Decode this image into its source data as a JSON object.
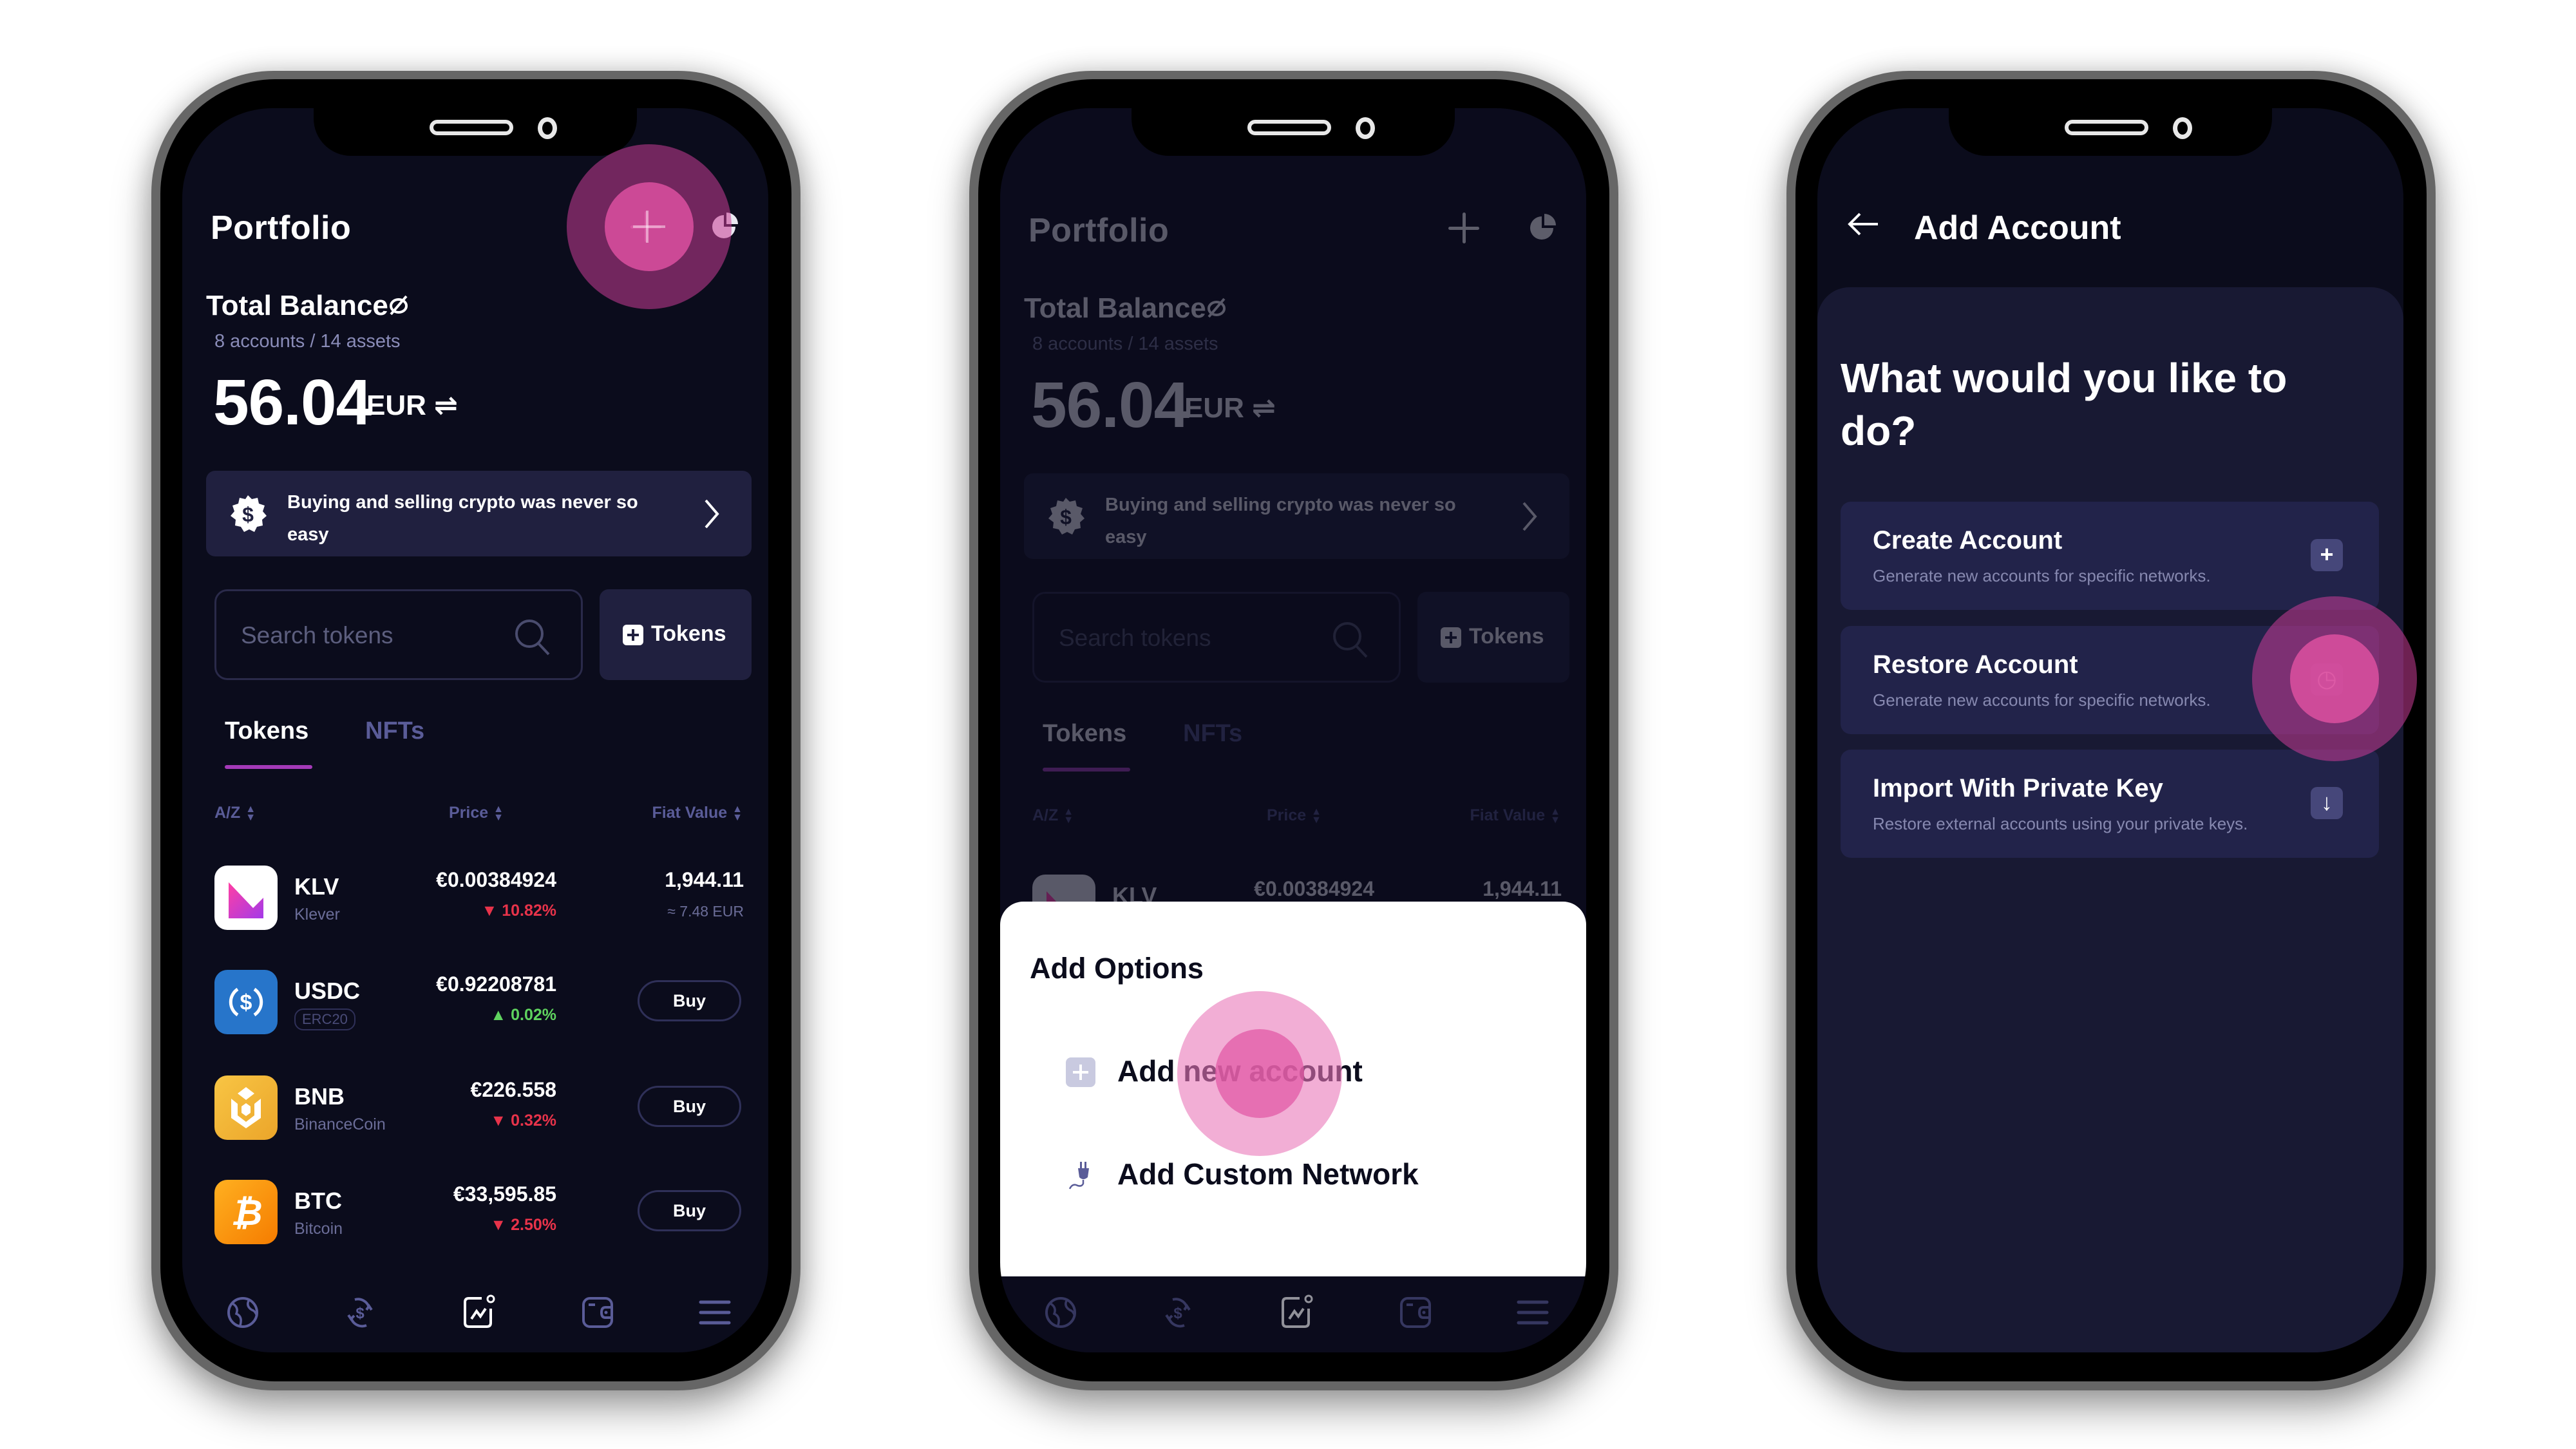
{
  "colors": {
    "background": "#ffffff",
    "screen_bg": "#0b0c1c",
    "card_bg": "#20203f",
    "accent_tab": "#a43ab8",
    "tap_highlight": "#d94a9e",
    "down": "#e8334a",
    "up": "#5fd35f",
    "muted_text": "#5a5c98"
  },
  "portfolio": {
    "title": "Portfolio",
    "add_icon": "plus-icon",
    "chart_icon": "pie-chart-icon",
    "balance_label": "Total Balance",
    "hide_icon": "eye-off-icon",
    "accounts_summary": "8 accounts / 14 assets",
    "balance_amount": "56.04",
    "balance_currency": "EUR",
    "currency_switch_icon": "swap-icon",
    "banner": {
      "icon": "dollar-badge-icon",
      "text": "Buying and selling crypto was never so easy",
      "chevron": "chevron-right-icon"
    },
    "search": {
      "placeholder": "Search tokens"
    },
    "add_tokens_label": "Tokens",
    "tabs": [
      {
        "label": "Tokens",
        "active": true
      },
      {
        "label": "NFTs",
        "active": false
      }
    ],
    "columns": {
      "name": "A/Z",
      "price": "Price",
      "fiat": "Fiat Value"
    },
    "tokens": [
      {
        "symbol": "KLV",
        "name": "Klever",
        "price": "€0.00384924",
        "change": "▼ 10.82%",
        "direction": "down",
        "fiat": "1,944.11",
        "fiat_sub": "≈ 7.48 EUR"
      },
      {
        "symbol": "USDC",
        "badge": "ERC20",
        "price": "€0.92208781",
        "change": "▲ 0.02%",
        "direction": "up",
        "action": "Buy"
      },
      {
        "symbol": "BNB",
        "name": "BinanceCoin",
        "price": "€226.558",
        "change": "▼ 0.32%",
        "direction": "down",
        "action": "Buy"
      },
      {
        "symbol": "BTC",
        "name": "Bitcoin",
        "price": "€33,595.85",
        "change": "▼ 2.50%",
        "direction": "down",
        "action": "Buy"
      }
    ],
    "nav": [
      "globe-icon",
      "exchange-dollar-icon",
      "portfolio-chart-icon",
      "wallet-icon",
      "menu-icon"
    ],
    "nav_active_index": 2
  },
  "add_options": {
    "title": "Add Options",
    "items": [
      {
        "label": "Add new account",
        "icon": "plus-square-icon"
      },
      {
        "label": "Add Custom Network",
        "icon": "plug-icon"
      }
    ]
  },
  "add_account": {
    "title": "Add Account",
    "back_icon": "arrow-left-icon",
    "heading": "What would you like to do?",
    "options": [
      {
        "title": "Create Account",
        "desc": "Generate new accounts for specific networks.",
        "icon": "+"
      },
      {
        "title": "Restore Account",
        "desc": "Generate new accounts for specific networks.",
        "icon": "◷"
      },
      {
        "title": "Import With Private Key",
        "desc": "Restore external accounts using your private keys.",
        "icon": "↓"
      }
    ]
  }
}
